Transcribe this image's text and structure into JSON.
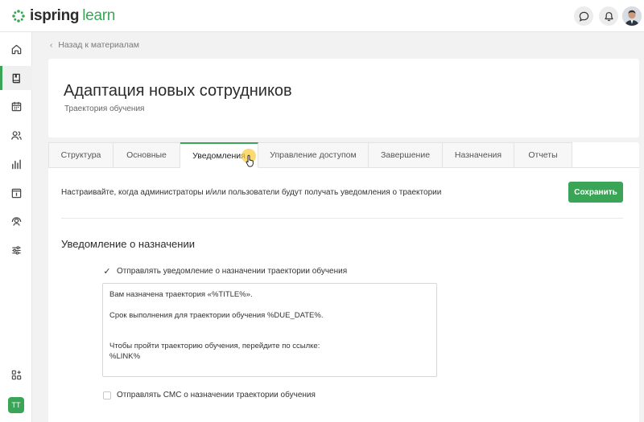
{
  "app": {
    "logo_word1": "ispring",
    "logo_word2": "learn",
    "brand_color": "#3aa557"
  },
  "topbar": {
    "icons": [
      "chat-icon",
      "bell-icon"
    ]
  },
  "sidebar": {
    "items": [
      {
        "icon": "home-icon",
        "active": false
      },
      {
        "icon": "book-icon",
        "active": true
      },
      {
        "icon": "calendar-icon",
        "active": false
      },
      {
        "icon": "users-icon",
        "active": false
      },
      {
        "icon": "bar-chart-icon",
        "active": false
      },
      {
        "icon": "info-board-icon",
        "active": false
      },
      {
        "icon": "user-support-icon",
        "active": false
      },
      {
        "icon": "sliders-icon",
        "active": false
      }
    ],
    "bottom_icon": "apps-add-icon",
    "user_initials": "TT"
  },
  "back_link": "Назад к материалам",
  "header": {
    "title": "Адаптация новых сотрудников",
    "subtitle": "Траектория обучения"
  },
  "tabs": [
    {
      "label": "Структура",
      "active": false
    },
    {
      "label": "Основные",
      "active": false
    },
    {
      "label": "Уведомления",
      "active": true
    },
    {
      "label": "Управление доступом",
      "active": false
    },
    {
      "label": "Завершение",
      "active": false
    },
    {
      "label": "Назначения",
      "active": false
    },
    {
      "label": "Отчеты",
      "active": false
    }
  ],
  "notifications": {
    "description": "Настраивайте, когда администраторы и/или пользователи будут получать уведомления о траектории",
    "save_label": "Сохранить",
    "section_title": "Уведомление о назначении",
    "email_checkbox_label": "Отправлять уведомление о назначении траектории обучения",
    "email_checked": true,
    "message_text": "Вам назначена траектория «%TITLE%».\n\nСрок выполнения для траектории обучения %DUE_DATE%.\n\n\nЧтобы пройти траекторию обучения, перейдите по ссылке:\n%LINK%",
    "sms_checkbox_label": "Отправлять СМС о назначении траектории обучения",
    "sms_checked": false
  }
}
